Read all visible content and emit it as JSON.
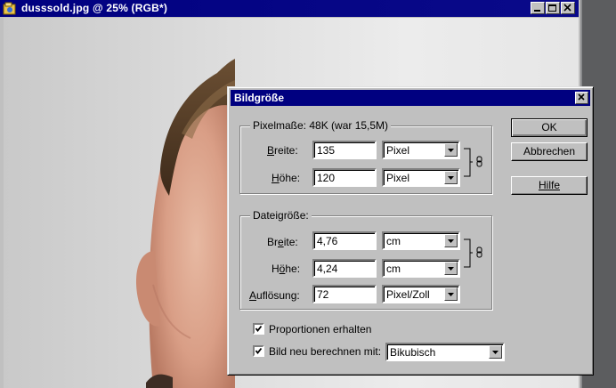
{
  "document_window": {
    "title": "dusssold.jpg @ 25% (RGB*)",
    "icon": "photoshop-file-icon",
    "buttons": [
      "minimize-icon",
      "maximize-icon",
      "close-icon"
    ]
  },
  "dialog": {
    "title": "Bildgröße",
    "pixel_dimensions": {
      "legend": "Pixelmaße: 48K (war 15,5M)",
      "width_label": "Breite:",
      "width_value": "135",
      "width_unit": "Pixel",
      "height_label": "Höhe:",
      "height_value": "120",
      "height_unit": "Pixel"
    },
    "document_size": {
      "legend": "Dateigröße:",
      "width_label": "Breite:",
      "width_value": "4,76",
      "width_unit": "cm",
      "height_label": "Höhe:",
      "height_value": "4,24",
      "height_unit": "cm",
      "resolution_label": "Auflösung:",
      "resolution_value": "72",
      "resolution_unit": "Pixel/Zoll"
    },
    "constrain_label": "Proportionen erhalten",
    "constrain_checked": true,
    "resample_label": "Bild neu berechnen mit:",
    "resample_checked": true,
    "resample_method": "Bikubisch",
    "buttons": {
      "ok": "OK",
      "cancel": "Abbrechen",
      "help": "Hilfe"
    }
  }
}
